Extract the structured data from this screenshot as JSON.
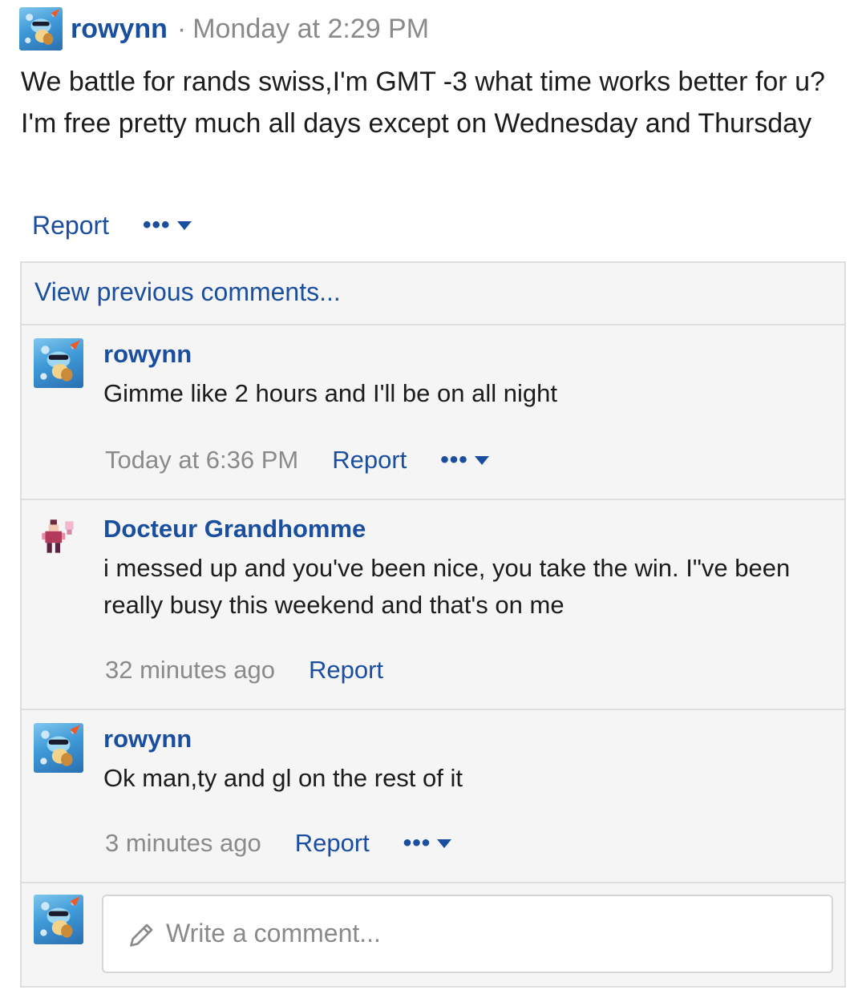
{
  "post": {
    "author": "rowynn",
    "separator": "·",
    "time": "Monday at 2:29 PM",
    "body": "We battle for rands swiss,I'm GMT -3 what time works better for u? I'm free pretty much all days except on Wednesday and Thursday",
    "report_label": "Report",
    "more_label": "•••"
  },
  "comments_section": {
    "view_previous_label": "View previous comments...",
    "items": [
      {
        "author": "rowynn",
        "text": "Gimme like 2 hours and I'll be on all night",
        "time": "Today at 6:36 PM",
        "report_label": "Report",
        "more_label": "•••",
        "avatar_icon": "squirtle-avatar-icon"
      },
      {
        "author": "Docteur Grandhomme",
        "text": "i messed up and you've been nice, you take the win. I\"ve been really busy this weekend and that's on me",
        "time": "32 minutes ago",
        "report_label": "Report",
        "avatar_icon": "pixel-character-avatar-icon"
      },
      {
        "author": "rowynn",
        "text": "Ok man,ty and gl on the rest of it",
        "time": "3 minutes ago",
        "report_label": "Report",
        "more_label": "•••",
        "avatar_icon": "squirtle-avatar-icon"
      }
    ],
    "composer": {
      "placeholder": "Write a comment..."
    }
  },
  "colors": {
    "link": "#1a4e9e",
    "muted": "#8a8a8a",
    "panel": "#f5f5f5",
    "border": "#dedede"
  }
}
